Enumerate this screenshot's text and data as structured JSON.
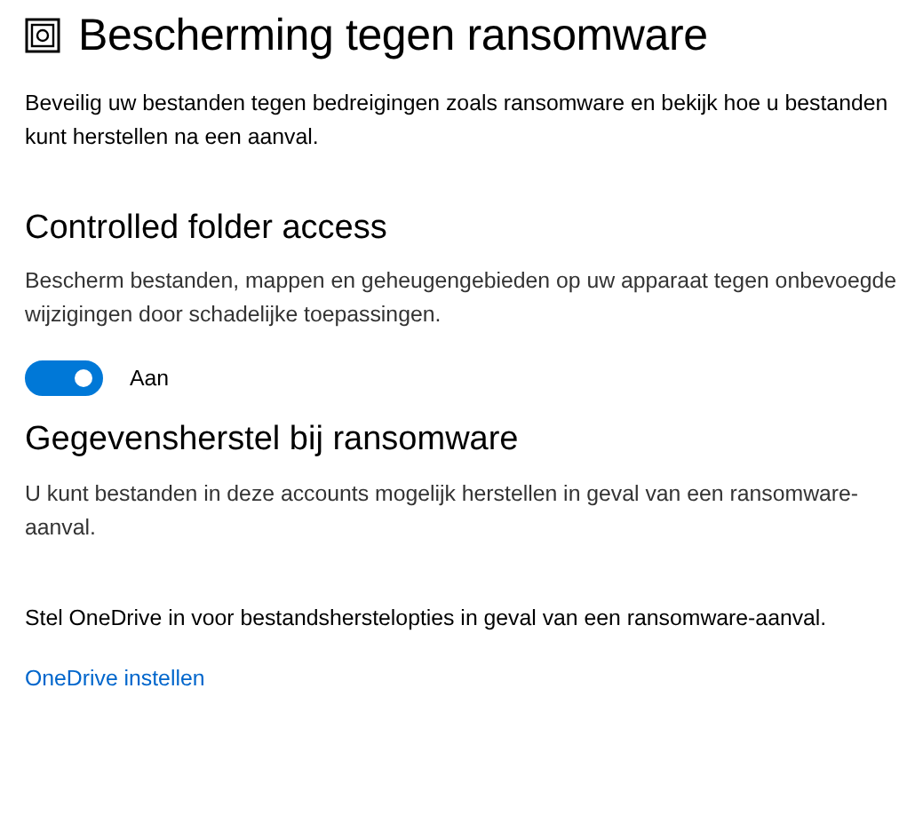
{
  "header": {
    "title": "Bescherming tegen ransomware",
    "description": "Beveilig uw bestanden tegen bedreigingen zoals ransomware en bekijk hoe u bestanden kunt herstellen na een aanval."
  },
  "controlled_folder_access": {
    "title": "Controlled folder access",
    "description": "Bescherm bestanden, mappen en geheugengebieden op uw apparaat tegen onbevoegde wijzigingen door schadelijke toepassingen.",
    "toggle": {
      "on": true,
      "label": "Aan"
    }
  },
  "recovery": {
    "title": "Gegevensherstel bij ransomware",
    "description": "U kunt bestanden in deze accounts mogelijk herstellen in geval van een ransomware-aanval.",
    "onedrive_text": "Stel OneDrive in voor bestandsherstelopties in geval van een ransomware-aanval.",
    "link": "OneDrive instellen"
  }
}
